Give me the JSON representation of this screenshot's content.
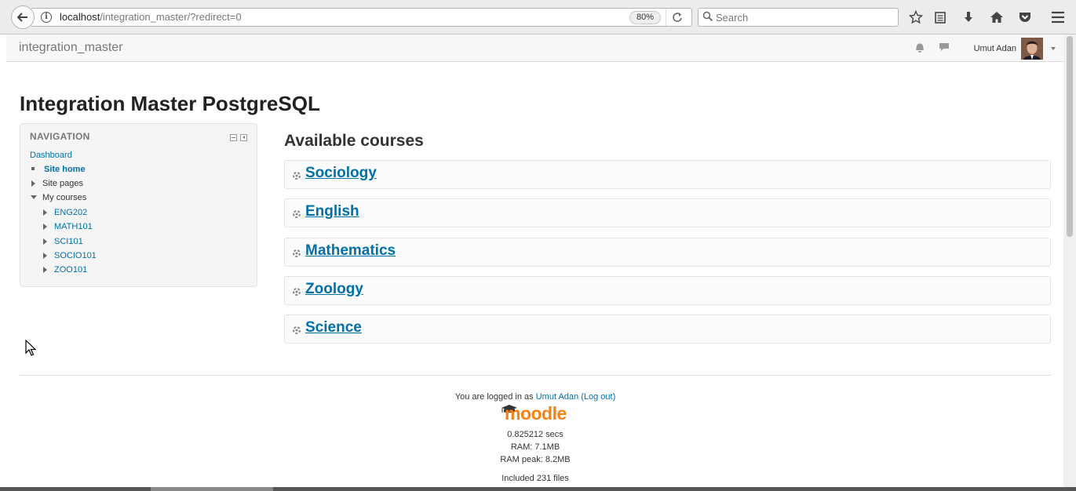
{
  "browser": {
    "url_host": "localhost",
    "url_path": "/integration_master/?redirect=0",
    "zoom": "80%",
    "search_placeholder": "Search"
  },
  "navbar": {
    "brand": "integration_master",
    "user_name": "Umut Adan"
  },
  "page": {
    "title": "Integration Master PostgreSQL"
  },
  "navigation": {
    "header": "NAVIGATION",
    "dashboard": "Dashboard",
    "site_home": "Site home",
    "site_pages": "Site pages",
    "my_courses": "My courses",
    "courses": [
      "ENG202",
      "MATH101",
      "SCI101",
      "SOCIO101",
      "ZOO101"
    ]
  },
  "available_courses": {
    "heading": "Available courses",
    "items": [
      "Sociology",
      "English",
      "Mathematics",
      "Zoology",
      "Science"
    ]
  },
  "footer": {
    "logged_in_prefix": "You are logged in as",
    "user_link": "Umut Adan",
    "logout_link": "(Log out)",
    "logo_text": "moodle",
    "time": "0.825212 secs",
    "ram": "RAM: 7.1MB",
    "ram_peak": "RAM peak: 8.2MB",
    "included": "Included 231 files"
  },
  "colors": {
    "link": "#0070a8",
    "moodle_orange": "#f98012"
  }
}
